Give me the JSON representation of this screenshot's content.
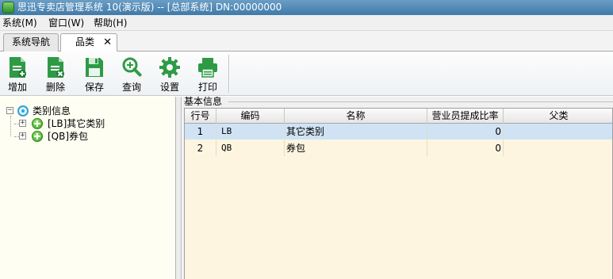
{
  "window": {
    "title": "思迅专卖店管理系统 10(演示版) -- [总部系统] DN:00000000"
  },
  "menu": {
    "items": [
      "系统(M)",
      "窗口(W)",
      "帮助(H)"
    ]
  },
  "tabs": [
    {
      "label": "系统导航"
    },
    {
      "label": "品类",
      "close": "✕"
    }
  ],
  "toolbar": {
    "buttons": [
      "增加",
      "删除",
      "保存",
      "查询",
      "设置",
      "打印"
    ]
  },
  "tree": {
    "root": {
      "label": "类别信息",
      "expander": "−"
    },
    "children": [
      {
        "label": "[LB]其它类别",
        "expander": "+"
      },
      {
        "label": "[QB]券包",
        "expander": "+"
      }
    ]
  },
  "group": {
    "title": "基本信息"
  },
  "grid": {
    "columns": [
      "行号",
      "编码",
      "名称",
      "营业员提成比率",
      "父类"
    ],
    "rows": [
      {
        "row_no": "1",
        "code": "LB",
        "name": "其它类别",
        "rate": "0",
        "parent": ""
      },
      {
        "row_no": "2",
        "code": "QB",
        "name": "券包",
        "rate": "0",
        "parent": ""
      }
    ]
  },
  "colors": {
    "titlebar": "#3f79a8",
    "selected_row": "#cfe3f5",
    "grid_bg": "#fdf5e0",
    "tree_bg": "#fffef2",
    "icon_green": "#3aa51f"
  }
}
